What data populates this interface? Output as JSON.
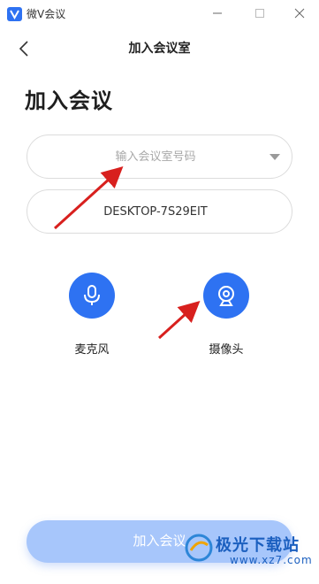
{
  "window": {
    "app_title": "微V会议",
    "brand_color": "#2e72f2"
  },
  "navbar": {
    "title": "加入会议室"
  },
  "heading": "加入会议",
  "room_field": {
    "placeholder": "输入会议室号码",
    "value": ""
  },
  "name_field": {
    "value": "DESKTOP-7S29EIT"
  },
  "devices": {
    "mic_label": "麦克风",
    "camera_label": "摄像头"
  },
  "join_button": {
    "label": "加入会议"
  },
  "watermark": {
    "text": "极光下载站",
    "url": "www.xz7.com"
  }
}
